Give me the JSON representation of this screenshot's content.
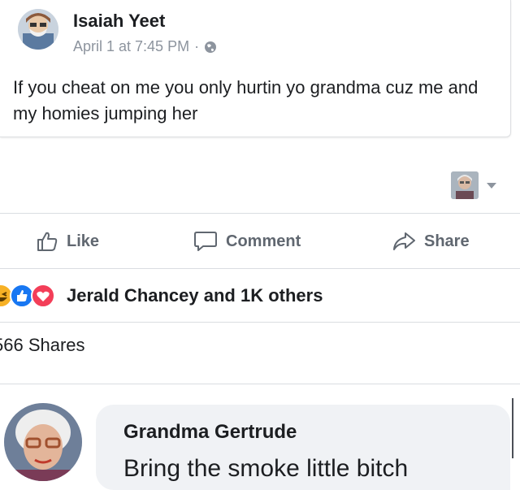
{
  "post": {
    "author": "Isaiah Yeet",
    "timestamp": "April 1 at 7:45 PM",
    "separator": "·",
    "privacy_icon": "globe-icon",
    "text": "If you cheat on me you only hurtin yo grandma cuz me and my homies jumping her"
  },
  "actions": {
    "like_label": "Like",
    "comment_label": "Comment",
    "share_label": "Share"
  },
  "reactions": {
    "icons": [
      "haha-reaction-icon",
      "like-reaction-icon",
      "love-reaction-icon"
    ],
    "summary": "Jerald Chancey and 1K others"
  },
  "shares": {
    "text": "566 Shares"
  },
  "comment": {
    "author": "Grandma Gertrude",
    "text": "Bring the smoke little bitch"
  },
  "colors": {
    "like_blue": "#1877f2",
    "love_red": "#f33e58",
    "haha_yellow": "#f7b125",
    "muted_gray": "#606770",
    "bubble_bg": "#f0f2f5"
  }
}
